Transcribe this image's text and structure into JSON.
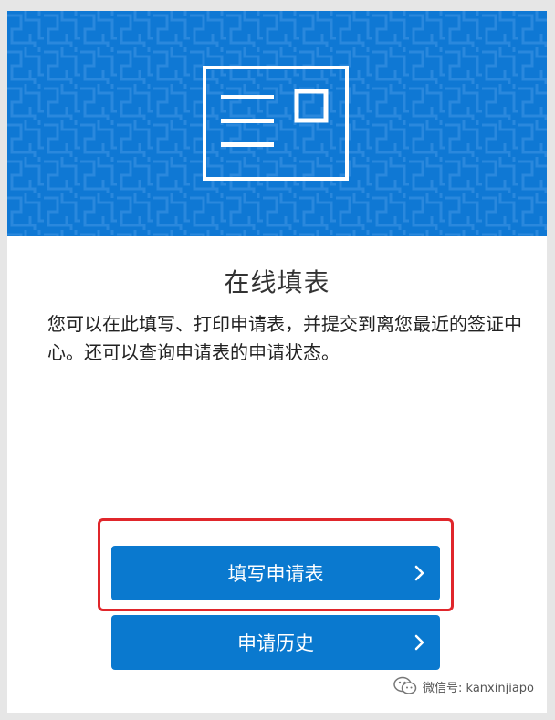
{
  "banner": {
    "icon": "form-card-icon",
    "color": "#0f78d4"
  },
  "card": {
    "title": "在线填表",
    "description": "您可以在此填写、打印申请表，并提交到离您最近的签证中心。还可以查询申请表的申请状态。"
  },
  "buttons": {
    "apply": {
      "label": "填写申请表",
      "icon": "chevron-right-icon"
    },
    "history": {
      "label": "申请历史",
      "icon": "chevron-right-icon"
    }
  },
  "accent": {
    "button": "#0a79cf",
    "highlight": "#e0262b"
  },
  "watermark": {
    "text": "微信号: kanxinjiapo",
    "icon": "wechat-icon"
  }
}
